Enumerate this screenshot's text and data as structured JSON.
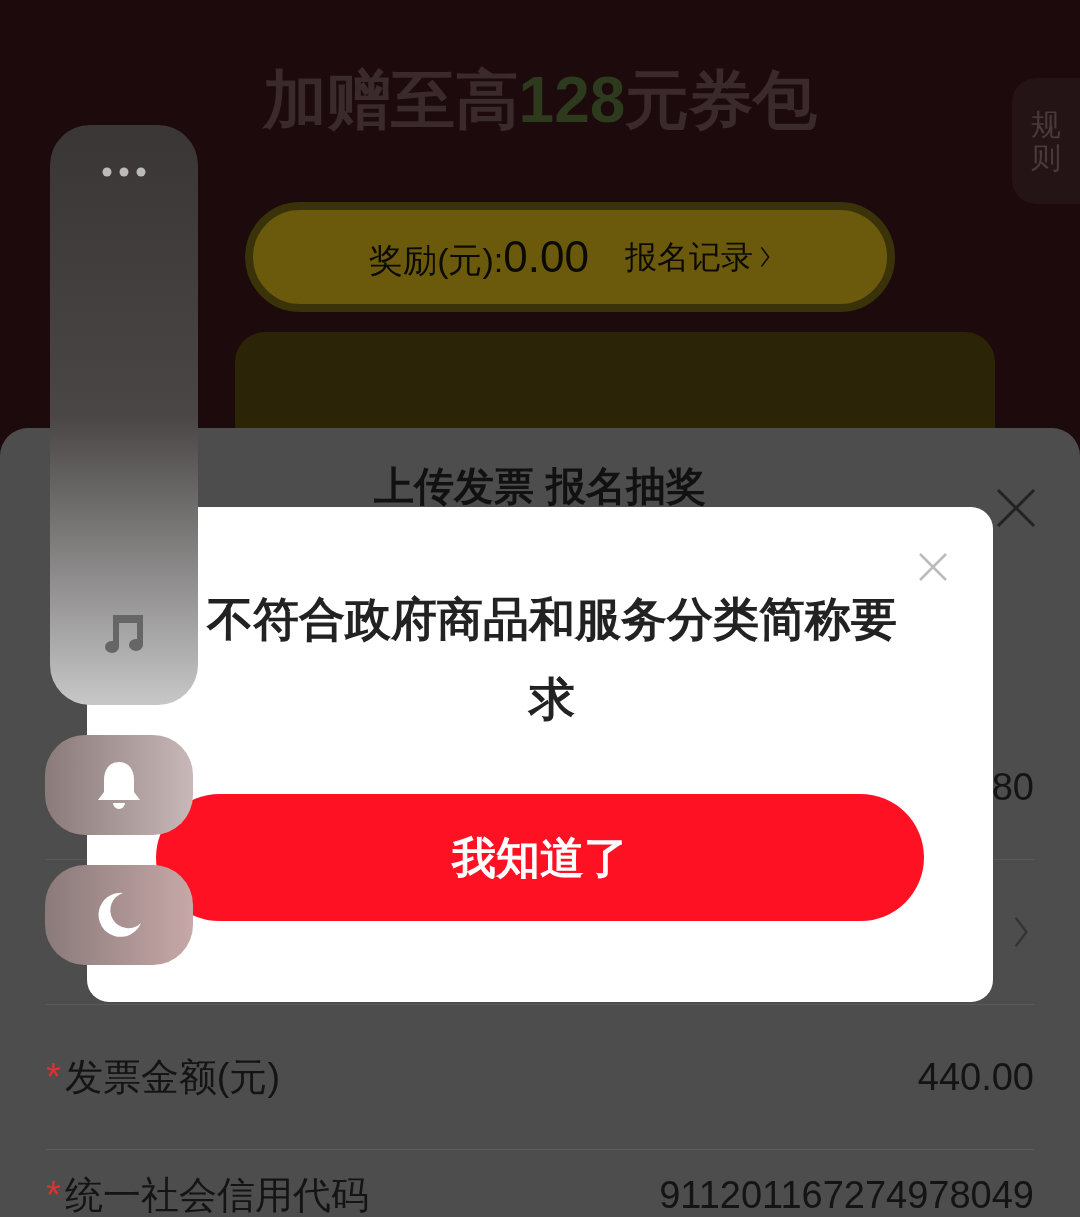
{
  "promo": {
    "subtitle_prefix": "加赠至高",
    "subtitle_amount": "128",
    "subtitle_suffix": "元券包",
    "rules_tab": "规则",
    "reward_label": "奖励(元):",
    "reward_value": "0.00",
    "records_link": "报名记录"
  },
  "sheet": {
    "title": "上传发票 报名抽奖",
    "rows": [
      {
        "kind": "value",
        "value": "80"
      },
      {
        "kind": "link"
      },
      {
        "kind": "value",
        "required_mark": "*",
        "label": "发票金额(元)",
        "value": "440.00"
      },
      {
        "kind": "value",
        "required_mark": "*",
        "label": "统一社会信用代码",
        "value": "911201167274978049"
      }
    ]
  },
  "dialog": {
    "message": "不符合政府商品和服务分类简称要求",
    "button": "我知道了"
  }
}
